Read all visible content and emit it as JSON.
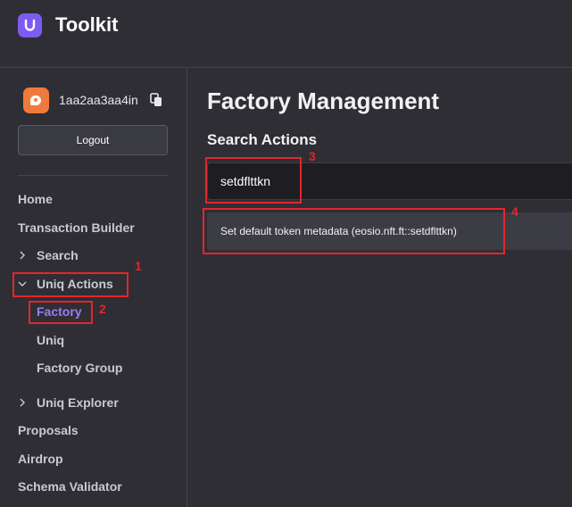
{
  "header": {
    "app_title": "Toolkit"
  },
  "account": {
    "name": "1aa2aa3aa4in",
    "logout_label": "Logout"
  },
  "sidebar": {
    "items": [
      {
        "label": "Home"
      },
      {
        "label": "Transaction Builder"
      },
      {
        "label": "Search",
        "icon": "chevron-right-icon"
      },
      {
        "label": "Uniq Actions",
        "icon": "chevron-down-icon"
      },
      {
        "label": "Factory"
      },
      {
        "label": "Uniq"
      },
      {
        "label": "Factory Group"
      },
      {
        "label": "Uniq Explorer",
        "icon": "chevron-right-icon"
      },
      {
        "label": "Proposals"
      },
      {
        "label": "Airdrop"
      },
      {
        "label": "Schema Validator"
      }
    ]
  },
  "main": {
    "title": "Factory Management",
    "section_title": "Search Actions",
    "search_value": "setdflttkn",
    "result": "Set default token metadata (eosio.nft.ft::setdflttkn)"
  },
  "annotations": [
    "1",
    "2",
    "3",
    "4"
  ],
  "colors": {
    "background": "#2e2e34",
    "accent": "#9b7cf5",
    "annotation": "#e3262b"
  }
}
